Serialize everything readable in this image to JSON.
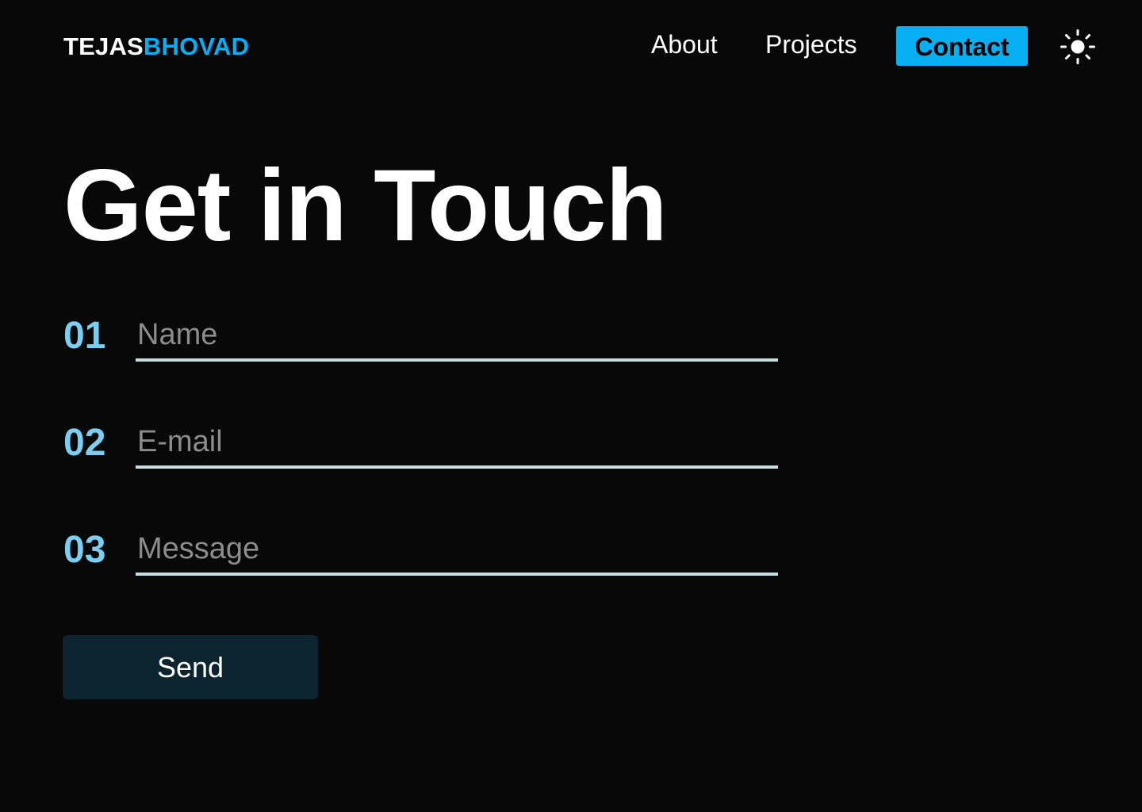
{
  "header": {
    "logo_first": "TEJAS",
    "logo_last": "BHOVAD",
    "nav": {
      "about": "About",
      "projects": "Projects",
      "contact": "Contact"
    },
    "theme_toggle_icon": "sun-icon"
  },
  "main": {
    "title": "Get in Touch",
    "form": {
      "fields": [
        {
          "number": "01",
          "placeholder": "Name",
          "value": ""
        },
        {
          "number": "02",
          "placeholder": "E-mail",
          "value": ""
        },
        {
          "number": "03",
          "placeholder": "Message",
          "value": ""
        }
      ],
      "send_label": "Send"
    }
  },
  "colors": {
    "background": "#080808",
    "accent": "#08aef2",
    "field_number": "#7ccdf0",
    "field_underline": "#c7dde0",
    "send_button": "#0c2330"
  }
}
